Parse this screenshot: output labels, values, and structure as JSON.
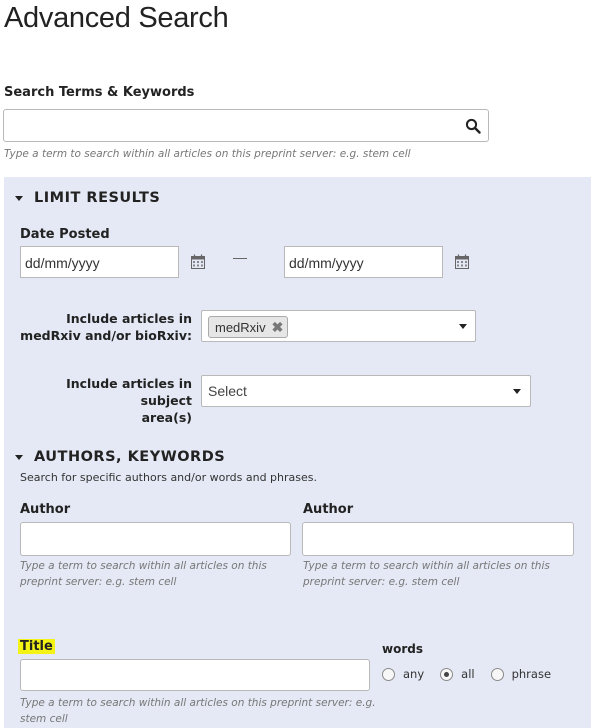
{
  "page": {
    "title": "Advanced Search"
  },
  "search": {
    "label": "Search Terms & Keywords",
    "value": "",
    "help": "Type a term to search within all articles on this preprint server: e.g. stem cell"
  },
  "limit_results": {
    "header": "LIMIT RESULTS",
    "date_posted": {
      "label": "Date Posted",
      "from_value": "dd/mm/yyyy",
      "to_value": "dd/mm/yyyy"
    },
    "server": {
      "label_line1": "Include articles in",
      "label_line2": "medRxiv and/or bioRxiv:",
      "selected_chip": "medRxiv",
      "chip_remove_glyph": "✖"
    },
    "subject": {
      "label_line1": "Include articles in subject",
      "label_line2": "area(s)",
      "selected_value": "Select"
    }
  },
  "authors_keywords": {
    "header": "AUTHORS, KEYWORDS",
    "description": "Search for specific authors and/or words and phrases.",
    "author_1": {
      "label": "Author",
      "value": "",
      "help_line1": "Type a term to search within all articles on this",
      "help_line2": "preprint server: e.g. stem cell"
    },
    "author_2": {
      "label": "Author",
      "value": "",
      "help_line1": "Type a term to search within all articles on this",
      "help_line2": "preprint server: e.g. stem cell"
    },
    "title": {
      "label": "Title",
      "value": "",
      "help_line1": "Type a term to search within all articles on this preprint server: e.g.",
      "help_line2": "stem cell"
    },
    "words": {
      "label": "words",
      "options": [
        "any",
        "all",
        "phrase"
      ],
      "selected": "all"
    }
  },
  "colors": {
    "panel_background": "#e5e9f5",
    "title_highlight": "#f3f315"
  }
}
